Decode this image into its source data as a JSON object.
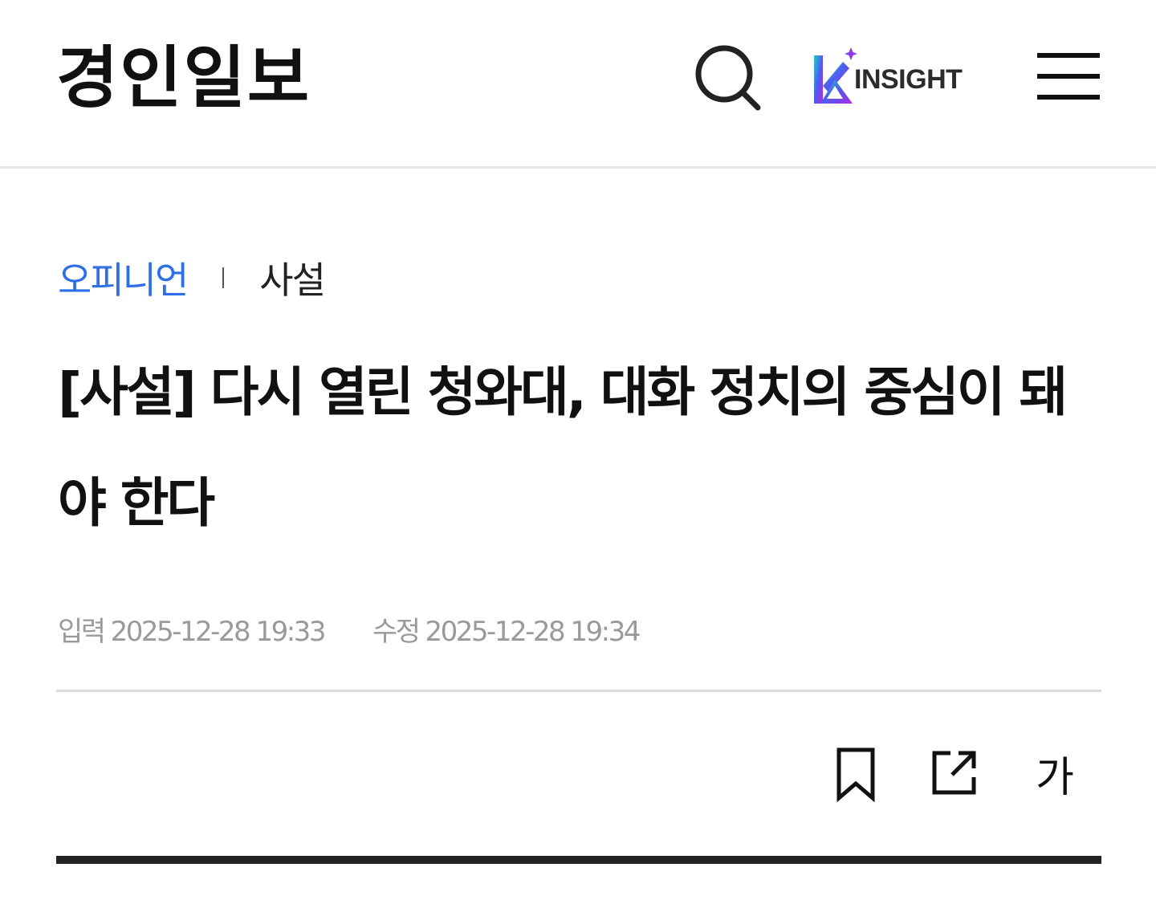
{
  "header": {
    "logo_text": "경인일보",
    "search_icon": "search-icon",
    "insight_label": "INSIGHT",
    "insight_icon": "k-insight-logo",
    "menu_icon": "hamburger-menu-icon"
  },
  "breadcrumb": {
    "section": "오피니언",
    "subsection": "사설"
  },
  "article": {
    "title": "[사설] 다시 열린 청와대, 대화 정치의 중심이 돼야 한다",
    "published_label": "입력",
    "published": "2025-12-28 19:33",
    "modified_label": "수정",
    "modified": "2025-12-28 19:34"
  },
  "tools": {
    "bookmark_icon": "bookmark-icon",
    "share_icon": "share-icon",
    "font_size_label": "가"
  },
  "colors": {
    "accent_blue": "#2f6fe6",
    "text_dark": "#111111",
    "text_muted": "#9a9a9a",
    "divider": "#e6e6e6",
    "rule_thick": "#222222",
    "insight_gradient_start": "#1fd1c6",
    "insight_gradient_end": "#8a2be2"
  }
}
